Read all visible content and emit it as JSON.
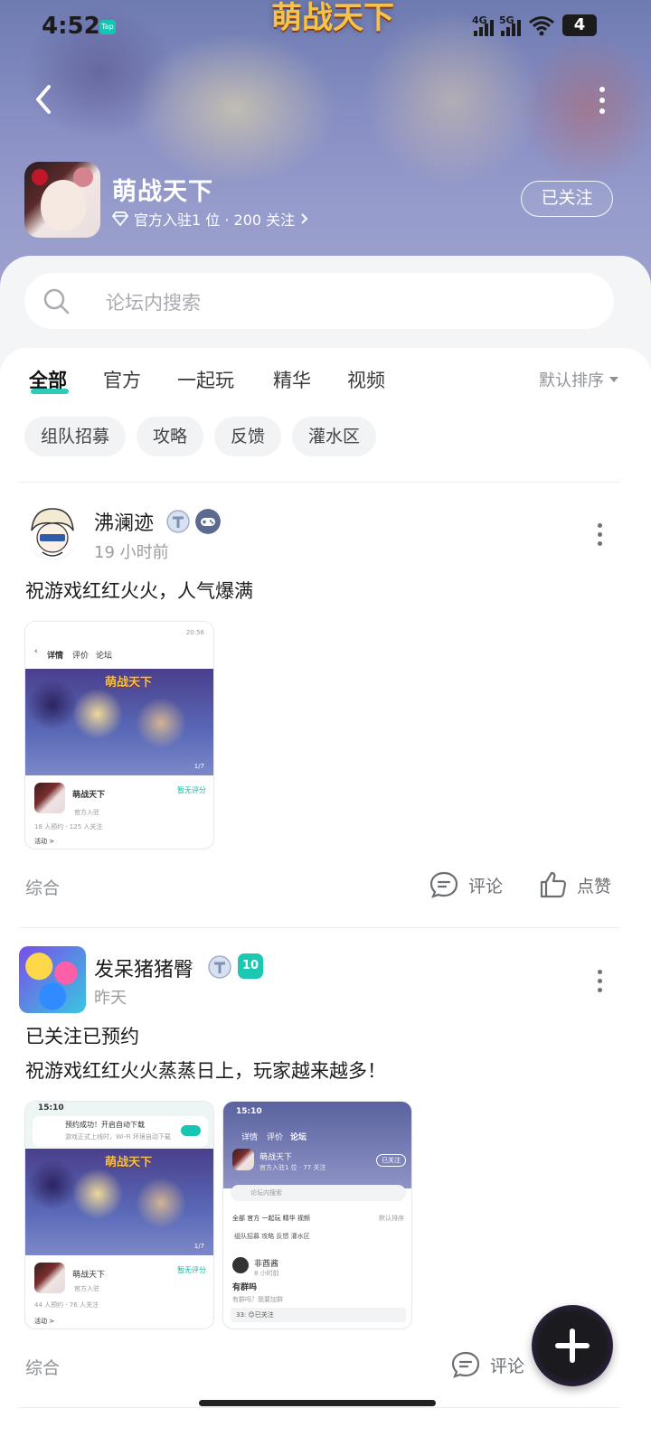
{
  "status_bar": {
    "time": "4:52",
    "app_icon_text": "Tap",
    "signal_1_label": "4G",
    "signal_2_label": "5G",
    "battery_level": "4"
  },
  "hero": {
    "art_title": "萌战天下",
    "game_name": "萌战天下",
    "meta": "官方入驻1 位 · 200 关注",
    "follow_label": "已关注"
  },
  "search": {
    "placeholder": "论坛内搜索"
  },
  "tabs": [
    "全部",
    "官方",
    "一起玩",
    "精华",
    "视频"
  ],
  "sort_label": "默认排序",
  "chips": [
    "组队招募",
    "攻略",
    "反馈",
    "灌水区"
  ],
  "posts": [
    {
      "username": "沸澜迹",
      "time": "19 小时前",
      "lines": [
        "祝游戏红红火火，人气爆满"
      ],
      "category": "综合",
      "comment_label": "评论",
      "like_label": "点赞",
      "thumbs": [
        {
          "status_time": "20:56",
          "tab_detail": "详情",
          "tab_review": "评价",
          "tab_forum": "论坛",
          "banner_title": "萌战天下",
          "pager": "1/7",
          "game_name": "萌战天下",
          "rating": "暂无评分",
          "official": "官方入驻",
          "stats": "18 人预约 · 125 人关注",
          "activity": "活动 >"
        }
      ]
    },
    {
      "username": "发呆猪猪臀",
      "time": "昨天",
      "lines": [
        "已关注已预约",
        "祝游戏红红火火蒸蒸日上，玩家越来越多！"
      ],
      "category": "综合",
      "comment_label": "评论",
      "level_badge": "10",
      "thumbs": [
        {
          "status_time": "15:10",
          "toast_title": "预约成功！开启自动下载",
          "toast_sub": "游戏正式上线时，Wi-Fi 环境自动下载",
          "banner_title": "萌战天下",
          "pager": "1/7",
          "game_name": "萌战天下",
          "rating": "暂无评分",
          "official": "官方入驻",
          "stats": "44 人预约 · 76 人关注",
          "activity": "活动 >"
        },
        {
          "status_time": "15:10",
          "tab_detail": "详情",
          "tab_review": "评价",
          "tab_forum": "论坛",
          "game_name": "萌战天下",
          "meta": "官方入驻1 位 · 77 关注",
          "follow": "已关注",
          "search": "论坛内搜索",
          "tabs": "全部  官方  一起玩  精华  视频",
          "sort": "默认排序",
          "chips": "组队招募  攻略  反馈  灌水区",
          "user": "非酋酱",
          "user_time": "8 小时前",
          "post_title": "有群吗",
          "post_body": "有群吗？我要加群",
          "reply": "33: 😊已关注"
        }
      ]
    }
  ],
  "colors": {
    "accent": "#16c6b0",
    "text": "#1d1d1f",
    "muted": "#8f9297"
  }
}
